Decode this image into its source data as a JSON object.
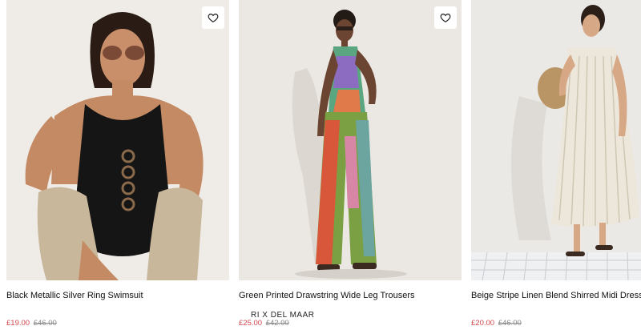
{
  "products": [
    {
      "title": "Black Metallic Silver Ring Swimsuit",
      "price_now": "£19.00",
      "price_was": "£46.00",
      "wishlist_icon": "heart-icon",
      "brand_tag": ""
    },
    {
      "title": "Green Printed Drawstring Wide Leg Trousers",
      "price_now": "£25.00",
      "price_was": "£42.00",
      "wishlist_icon": "heart-icon",
      "brand_tag": "RI X DEL MAAR"
    },
    {
      "title": "Beige Stripe Linen Blend Shirred Midi Dress",
      "price_now": "£20.00",
      "price_was": "£46.00",
      "wishlist_icon": "heart-icon",
      "brand_tag": ""
    }
  ],
  "colors": {
    "sale_price": "#d2484f",
    "was_price": "#888888",
    "photo_background": "#ebe8e2"
  }
}
